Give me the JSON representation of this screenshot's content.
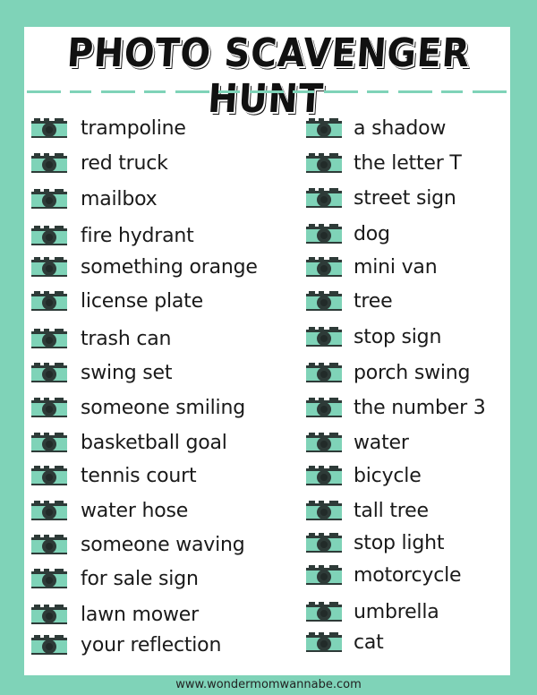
{
  "title": "PHOTO SCAVENGER HUNT",
  "colors": {
    "accent": "#7fd3b8",
    "icon_dark": "#2e3b38",
    "text": "#1a1a1a"
  },
  "icon": "camera-icon",
  "left_items": [
    "trampoline",
    "red truck",
    "mailbox",
    "fire hydrant",
    "something orange",
    "license plate",
    "trash can",
    "swing set",
    "someone smiling",
    "basketball goal",
    "tennis court",
    "water hose",
    "someone waving",
    "for sale sign",
    "lawn mower",
    "your reflection"
  ],
  "right_items": [
    "a shadow",
    "the letter T",
    "street sign",
    "dog",
    "mini van",
    "tree",
    "stop sign",
    "porch swing",
    "the number 3",
    "water",
    "bicycle",
    "tall tree",
    "stop light",
    "motorcycle",
    "umbrella",
    "cat"
  ],
  "footer": "www.wondermomwannabe.com"
}
